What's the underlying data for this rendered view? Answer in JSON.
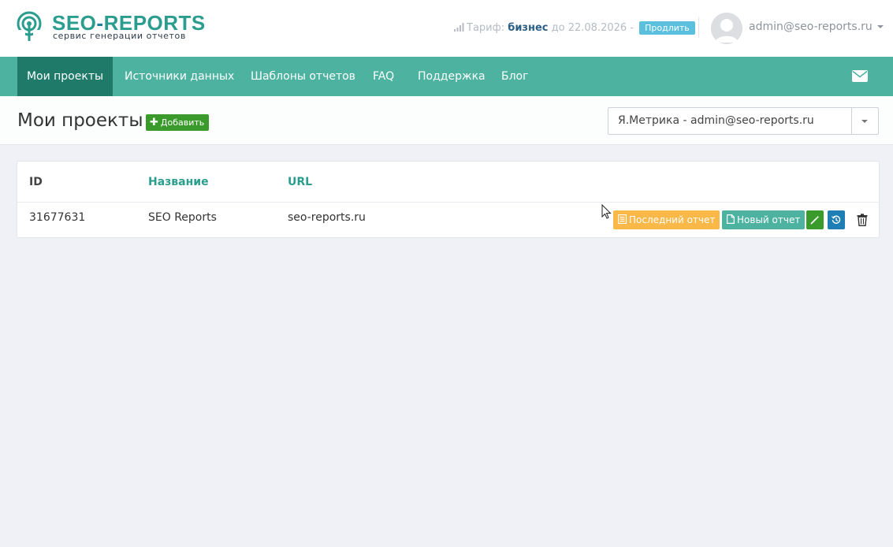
{
  "header": {
    "logo_title_a": "SEO",
    "logo_title_dash": "-",
    "logo_title_b": "REPORTS",
    "logo_subtitle": "сервис генерации отчетов",
    "tariff_label": "Тариф:",
    "tariff_plan": "бизнес",
    "tariff_until": "до 22.08.2026 -",
    "extend_label": "Продлить",
    "user_email": "admin@seo-reports.ru"
  },
  "nav": {
    "items": [
      {
        "label": "Мои проекты",
        "active": true
      },
      {
        "label": "Источники данных"
      },
      {
        "label": "Шаблоны отчетов"
      },
      {
        "label": "FAQ"
      },
      {
        "label": "Поддержка"
      },
      {
        "label": "Блог"
      }
    ],
    "mail_icon": "envelope-icon"
  },
  "page": {
    "title": "Мои проекты",
    "add_label": "Добавить",
    "source_select_value": "Я.Метрика - admin@seo-reports.ru"
  },
  "table": {
    "columns": [
      "ID",
      "Название",
      "URL"
    ],
    "rows": [
      {
        "id": "31677631",
        "name": "SEO Reports",
        "url": "seo-reports.ru",
        "last_report_label": "Последний отчет",
        "new_report_label": "Новый отчет"
      }
    ]
  },
  "colors": {
    "brand": "#2a9d8f",
    "nav_bg": "#4db3a0",
    "nav_active": "#1f7a6a",
    "add_button": "#3a9a2b",
    "last_report": "#f9b847",
    "history_button": "#1f7fb5",
    "extend_button": "#5bc0de"
  }
}
